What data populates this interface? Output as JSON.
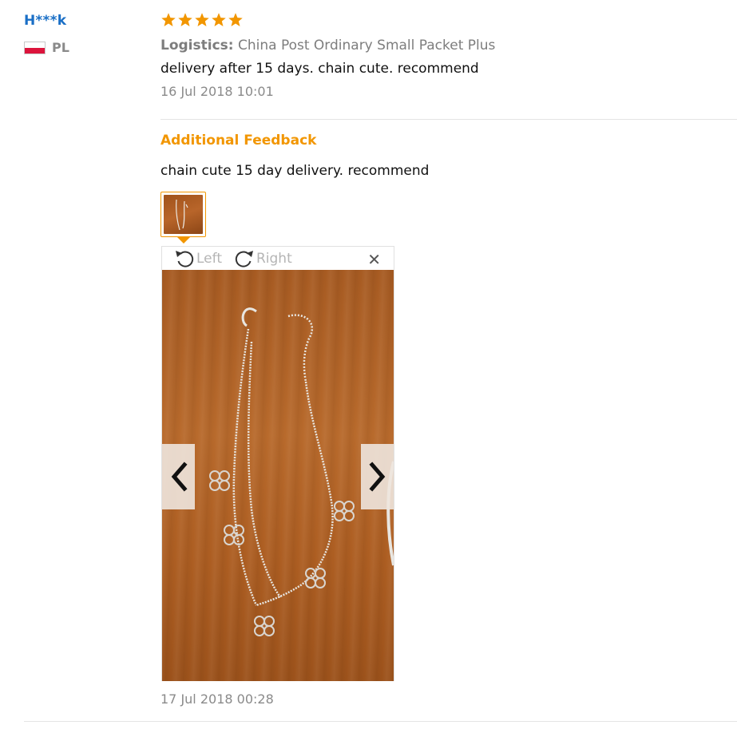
{
  "user": {
    "name": "H***k",
    "country": "PL"
  },
  "review": {
    "stars": 5,
    "logistics_label": "Logistics:",
    "logistics_value": "China Post Ordinary Small Packet Plus",
    "text": "delivery after 15 days. chain cute. recommend",
    "date": "16 Jul 2018 10:01"
  },
  "additional": {
    "title": "Additional Feedback",
    "text": "chain cute 15 day delivery. recommend",
    "viewer": {
      "rotate_left": "Left",
      "rotate_right": "Right"
    },
    "date": "17 Jul 2018 00:28"
  },
  "colors": {
    "link": "#1a6fc6",
    "accent": "#f29600",
    "star": "#f29600",
    "muted": "#8a8a8a"
  },
  "icons": {
    "star": "star-icon",
    "rotate_left": "rotate-left-icon",
    "rotate_right": "rotate-right-icon",
    "close": "close-icon",
    "prev": "chevron-left-icon",
    "next": "chevron-right-icon"
  }
}
